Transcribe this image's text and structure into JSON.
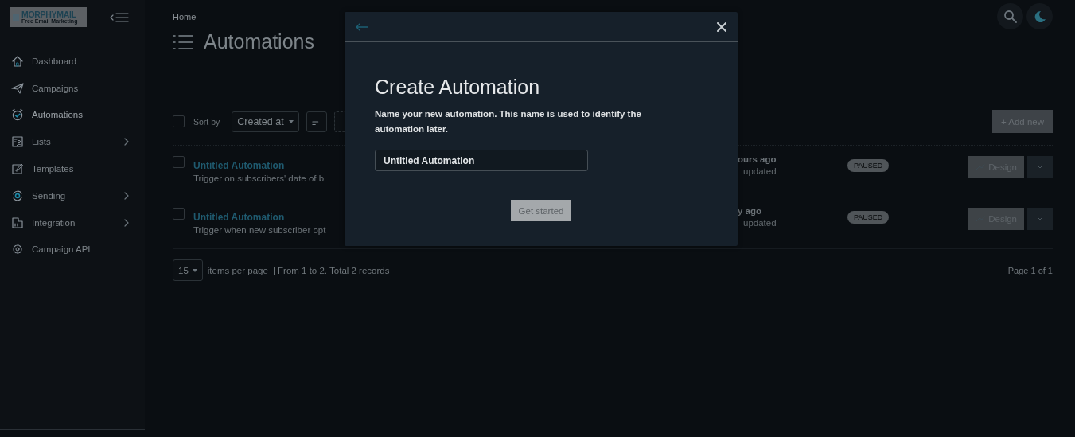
{
  "sidebar": {
    "logo": {
      "title": "MORPHYMAIL",
      "tagline": "Free Email Marketing"
    },
    "items": [
      {
        "label": "Dashboard",
        "has_submenu": false,
        "selected": false
      },
      {
        "label": "Campaigns",
        "has_submenu": false,
        "selected": false
      },
      {
        "label": "Automations",
        "has_submenu": false,
        "selected": true
      },
      {
        "label": "Lists",
        "has_submenu": true,
        "selected": false
      },
      {
        "label": "Templates",
        "has_submenu": false,
        "selected": false
      },
      {
        "label": "Sending",
        "has_submenu": true,
        "selected": false
      },
      {
        "label": "Integration",
        "has_submenu": true,
        "selected": false
      },
      {
        "label": "Campaign API",
        "has_submenu": false,
        "selected": false
      }
    ]
  },
  "breadcrumb": "Home",
  "page_title": "Automations",
  "toolbar": {
    "select_all_checked": false,
    "sort_label": "Sort by",
    "sort_value": "Created at",
    "add_button": "+ Add new"
  },
  "rows": [
    {
      "checked": false,
      "name": "Untitled Automation",
      "description": "Trigger on subscribers' date of b",
      "time": "ours ago",
      "time_note": "updated",
      "status": "PAUSED",
      "design_button": "Design"
    },
    {
      "checked": false,
      "name": "Untitled Automation",
      "description": "Trigger when new subscriber opt",
      "time": "y ago",
      "time_note": "updated",
      "status": "PAUSED",
      "design_button": "Design"
    }
  ],
  "pagination": {
    "per_page": "15",
    "per_page_label": "items per page",
    "summary": "| From 1 to 2. Total 2 records",
    "page": "Page 1 of 1"
  },
  "modal": {
    "title": "Create Automation",
    "description": "Name your new automation. This name is used to identify the automation later.",
    "name_value": "Untitled Automation",
    "submit": "Get started"
  }
}
